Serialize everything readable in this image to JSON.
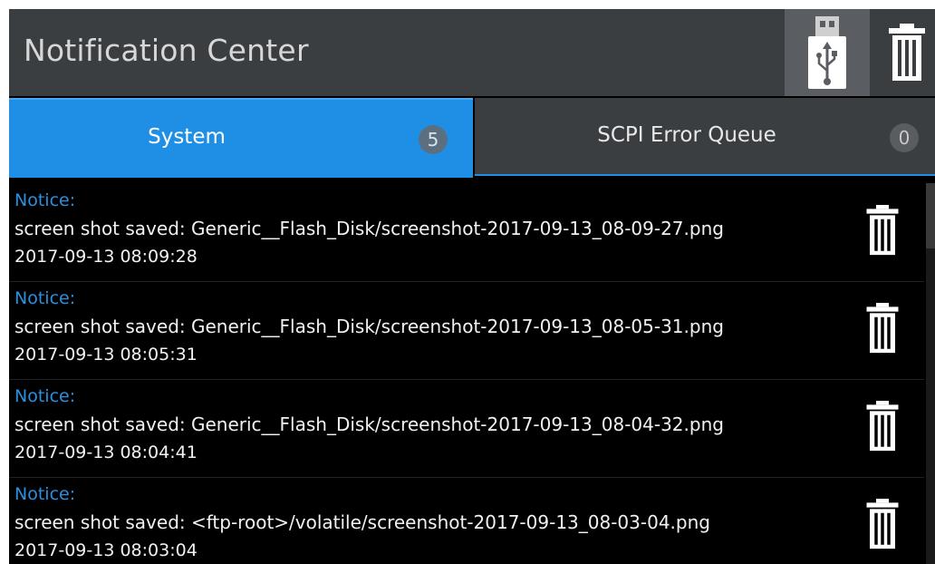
{
  "header": {
    "title": "Notification Center",
    "usb_icon": "usb-drive-icon",
    "delete_all_icon": "trash-icon"
  },
  "tabs": [
    {
      "label": "System",
      "count": "5",
      "active": true
    },
    {
      "label": "SCPI Error Queue",
      "count": "0",
      "active": false
    }
  ],
  "notifications": [
    {
      "type": "Notice:",
      "message": "screen shot saved: Generic__Flash_Disk/screenshot-2017-09-13_08-09-27.png",
      "time": "2017-09-13 08:09:28"
    },
    {
      "type": "Notice:",
      "message": "screen shot saved: Generic__Flash_Disk/screenshot-2017-09-13_08-05-31.png",
      "time": "2017-09-13 08:05:31"
    },
    {
      "type": "Notice:",
      "message": "screen shot saved: Generic__Flash_Disk/screenshot-2017-09-13_08-04-32.png",
      "time": "2017-09-13 08:04:41"
    },
    {
      "type": "Notice:",
      "message": "screen shot saved: <ftp-root>/volatile/screenshot-2017-09-13_08-03-04.png",
      "time": "2017-09-13 08:03:04"
    }
  ],
  "colors": {
    "accent": "#1f8fe6",
    "header_bg": "#3b3e41",
    "notice_label": "#2a90e0",
    "background": "#000000"
  }
}
